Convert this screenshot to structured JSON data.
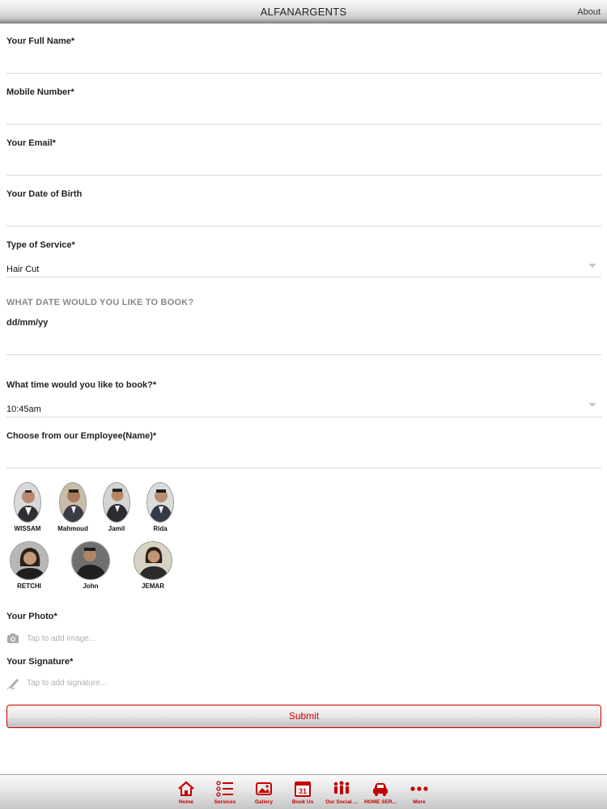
{
  "header": {
    "title": "ALFANARGENTS",
    "about": "About"
  },
  "form": {
    "full_name_label": "Your Full Name*",
    "mobile_label": "Mobile Number*",
    "email_label": "Your Email*",
    "dob_label": "Your Date of Birth",
    "service_label": "Type of Service*",
    "service_value": "Hair Cut",
    "booking_date_heading": "WHAT DATE WOULD YOU LIKE TO BOOK?",
    "booking_date_value": "dd/mm/yy",
    "time_label": "What time would you like to book?*",
    "time_value": "10:45am",
    "employee_label": "Choose from our Employee(Name)*",
    "photo_label": "Your Photo*",
    "photo_hint": "Tap to add image...",
    "signature_label": "Your Signature*",
    "signature_hint": "Tap to add signature...",
    "submit_label": "Submit"
  },
  "employees": [
    "WISSAM",
    "Mahmoud",
    "Jamil",
    "Rida",
    "RETCHI",
    "John",
    "JEMAR"
  ],
  "tabs": [
    {
      "label": "Home",
      "icon": "home-icon"
    },
    {
      "label": "Services",
      "icon": "list-icon"
    },
    {
      "label": "Gallery",
      "icon": "gallery-icon"
    },
    {
      "label": "Book Us",
      "icon": "calendar-icon"
    },
    {
      "label": "Our Social ...",
      "icon": "people-icon"
    },
    {
      "label": "HOME SER...",
      "icon": "car-icon"
    },
    {
      "label": "More",
      "icon": "more-icon"
    }
  ],
  "colors": {
    "accent": "#c40000",
    "divider": "#d8d8d8",
    "heading_gray": "#888888"
  }
}
